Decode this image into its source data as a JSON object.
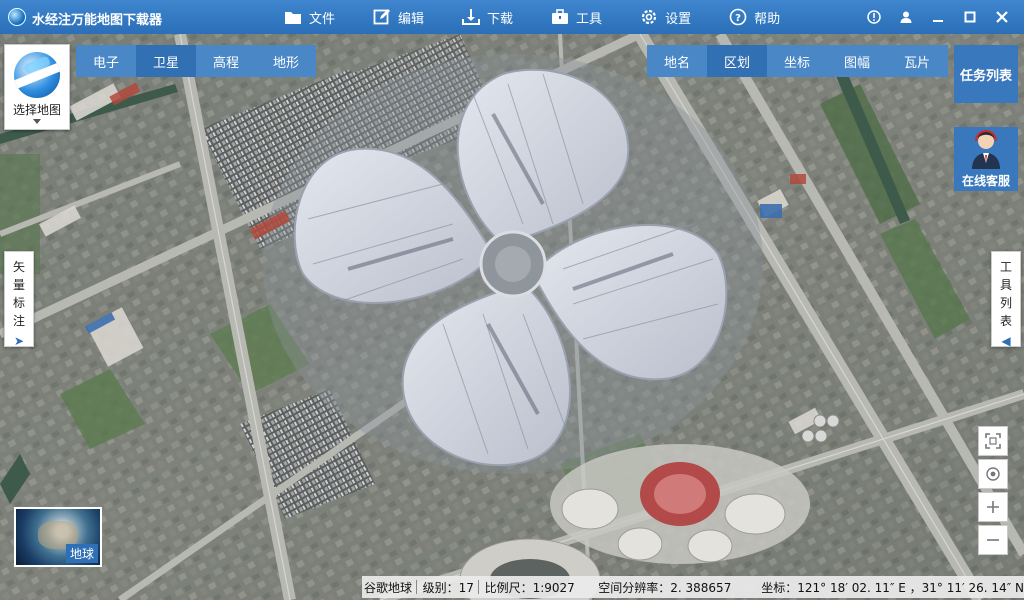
{
  "app": {
    "title": "水经注万能地图下载器"
  },
  "menu": [
    {
      "label": "文件",
      "icon": "folder-icon"
    },
    {
      "label": "编辑",
      "icon": "edit-icon"
    },
    {
      "label": "下载",
      "icon": "download-icon"
    },
    {
      "label": "工具",
      "icon": "toolbox-icon"
    },
    {
      "label": "设置",
      "icon": "gear-icon"
    },
    {
      "label": "帮助",
      "icon": "help-icon"
    }
  ],
  "map_selector": {
    "label": "选择地图"
  },
  "left_tabs": [
    "电子",
    "卫星",
    "高程",
    "地形"
  ],
  "left_tabs_active": "卫星",
  "right_tabs": [
    "地名",
    "区划",
    "坐标",
    "图幅",
    "瓦片"
  ],
  "right_tabs_active": "区划",
  "task_list": {
    "label": "任务列表"
  },
  "online_service": {
    "label": "在线客服"
  },
  "vector_labels": {
    "label": "矢量标注"
  },
  "tool_list": {
    "label": "工具列表"
  },
  "earth": {
    "label": "地球"
  },
  "status": {
    "source": "谷歌地球",
    "level": "级别：17",
    "scale": "比例尺：1:9027",
    "resolution": "空间分辨率：2. 388657",
    "coords": "坐标：121° 18′ 02. 11″ E ，31° 11′ 26. 14″ N"
  },
  "colors": {
    "titlebar": "#2f72b9",
    "tab": "#4a87c7",
    "tab_active": "#3170b3"
  }
}
